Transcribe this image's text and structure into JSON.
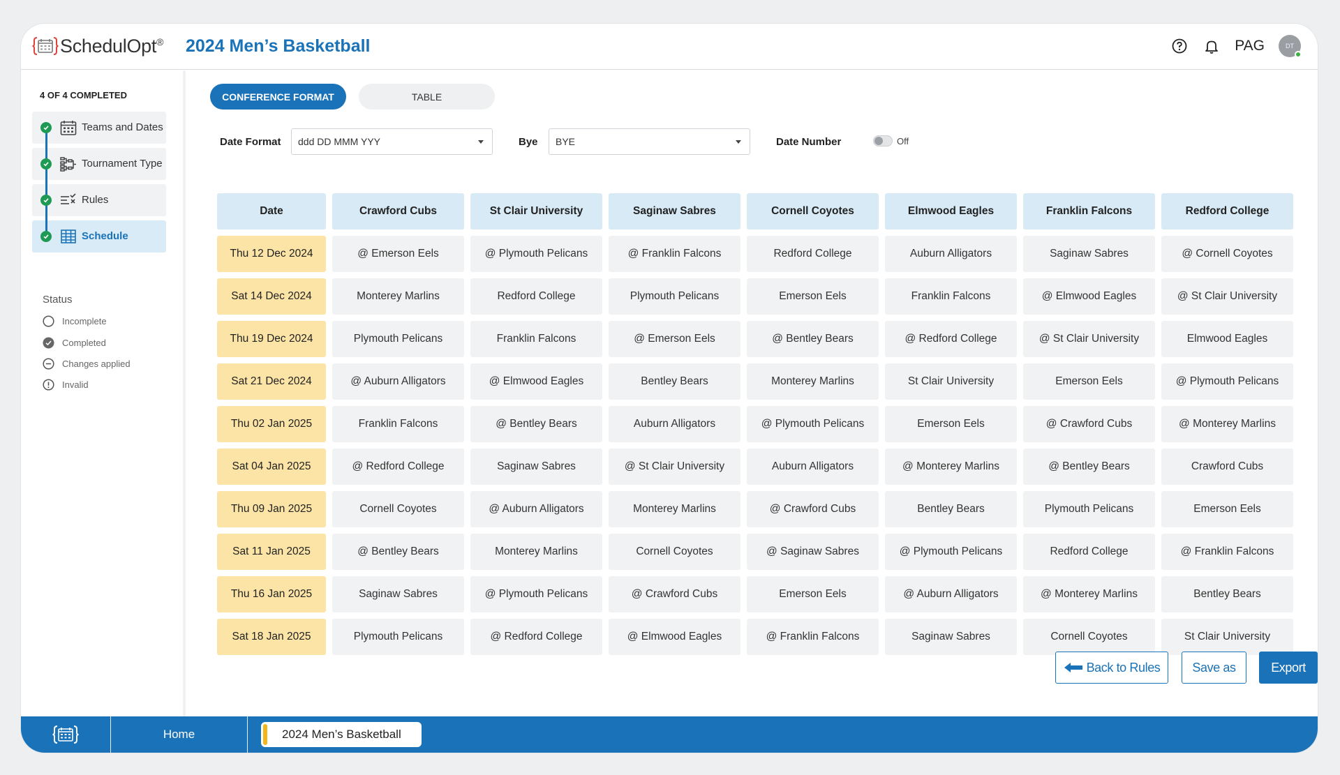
{
  "header": {
    "logo_text": "SchedulOpt",
    "logo_reg": "®",
    "title": "2024 Men’s Basketball",
    "user_label": "PAG",
    "avatar_initials": "DT"
  },
  "sidebar": {
    "progress_label": "4 OF 4 COMPLETED",
    "steps": [
      {
        "label": "Teams and Dates",
        "icon": "calendar-icon"
      },
      {
        "label": "Tournament Type",
        "icon": "bracket-icon"
      },
      {
        "label": "Rules",
        "icon": "rules-icon"
      },
      {
        "label": "Schedule",
        "icon": "table-icon"
      }
    ],
    "status_title": "Status",
    "status_items": [
      {
        "label": "Incomplete",
        "icon": "empty-circle-icon"
      },
      {
        "label": "Completed",
        "icon": "check-circle-icon"
      },
      {
        "label": "Changes applied",
        "icon": "minus-circle-icon"
      },
      {
        "label": "Invalid",
        "icon": "exclamation-circle-icon"
      }
    ]
  },
  "view_toggle": {
    "conference_label": "CONFERENCE FORMAT",
    "table_label": "TABLE"
  },
  "controls": {
    "date_format_label": "Date Format",
    "date_format_value": "ddd DD MMM YYY",
    "bye_label": "Bye",
    "bye_value": "BYE",
    "date_number_label": "Date Number",
    "date_number_state": "Off"
  },
  "schedule": {
    "headers": [
      "Date",
      "Crawford Cubs",
      "St Clair University",
      "Saginaw Sabres",
      "Cornell Coyotes",
      "Elmwood Eagles",
      "Franklin Falcons",
      "Redford College"
    ],
    "rows": [
      [
        "Thu 12 Dec 2024",
        "@ Emerson Eels",
        "@ Plymouth Pelicans",
        "@ Franklin Falcons",
        "Redford College",
        "Auburn Alligators",
        "Saginaw Sabres",
        "@ Cornell Coyotes"
      ],
      [
        "Sat 14 Dec 2024",
        "Monterey Marlins",
        "Redford College",
        "Plymouth Pelicans",
        "Emerson Eels",
        "Franklin Falcons",
        "@ Elmwood Eagles",
        "@ St Clair University"
      ],
      [
        "Thu 19 Dec 2024",
        "Plymouth Pelicans",
        "Franklin Falcons",
        "@ Emerson Eels",
        "@ Bentley Bears",
        "@ Redford College",
        "@ St Clair University",
        "Elmwood Eagles"
      ],
      [
        "Sat 21 Dec 2024",
        "@ Auburn Alligators",
        "@ Elmwood Eagles",
        "Bentley Bears",
        "Monterey Marlins",
        "St Clair University",
        "Emerson Eels",
        "@ Plymouth Pelicans"
      ],
      [
        "Thu 02 Jan 2025",
        "Franklin Falcons",
        "@ Bentley Bears",
        "Auburn Alligators",
        "@ Plymouth Pelicans",
        "Emerson Eels",
        "@ Crawford Cubs",
        "@ Monterey Marlins"
      ],
      [
        "Sat 04 Jan 2025",
        "@ Redford College",
        "Saginaw Sabres",
        "@ St Clair University",
        "Auburn Alligators",
        "@ Monterey Marlins",
        "@ Bentley Bears",
        "Crawford Cubs"
      ],
      [
        "Thu 09 Jan 2025",
        "Cornell Coyotes",
        "@ Auburn Alligators",
        "Monterey Marlins",
        "@ Crawford Cubs",
        "Bentley Bears",
        "Plymouth Pelicans",
        "Emerson Eels"
      ],
      [
        "Sat 11 Jan 2025",
        "@ Bentley Bears",
        "Monterey Marlins",
        "Cornell Coyotes",
        "@ Saginaw Sabres",
        "@ Plymouth Pelicans",
        "Redford College",
        "@ Franklin Falcons"
      ],
      [
        "Thu 16 Jan 2025",
        "Saginaw Sabres",
        "@ Plymouth Pelicans",
        "@ Crawford Cubs",
        "Emerson Eels",
        "@ Auburn Alligators",
        "@ Monterey Marlins",
        "Bentley Bears"
      ],
      [
        "Sat 18 Jan 2025",
        "Plymouth Pelicans",
        "@ Redford College",
        "@ Elmwood Eagles",
        "@ Franklin Falcons",
        "Saginaw Sabres",
        "Cornell Coyotes",
        "St Clair University"
      ]
    ]
  },
  "actions": {
    "back_label": "Back to Rules",
    "save_as_label": "Save as",
    "export_label": "Export"
  },
  "footer": {
    "home_label": "Home",
    "tab_label": "2024 Men’s Basketball"
  },
  "colors": {
    "brand_blue": "#1a73b8",
    "date_cell": "#fbe4a6",
    "header_cell": "#d7eaf5",
    "cell": "#f1f2f3",
    "complete_green": "#1e9a55",
    "tab_accent": "#f2b51b"
  }
}
